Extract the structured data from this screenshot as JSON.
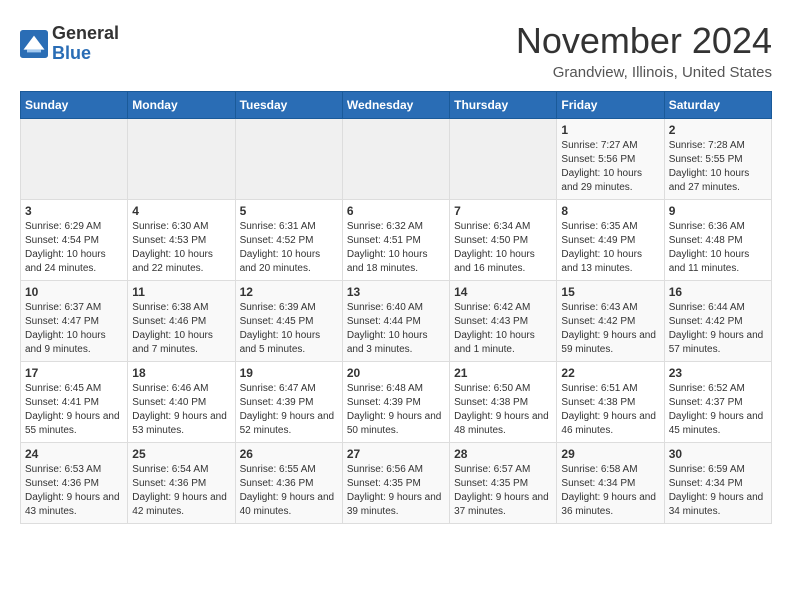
{
  "header": {
    "logo_line1": "General",
    "logo_line2": "Blue",
    "month": "November 2024",
    "location": "Grandview, Illinois, United States"
  },
  "weekdays": [
    "Sunday",
    "Monday",
    "Tuesday",
    "Wednesday",
    "Thursday",
    "Friday",
    "Saturday"
  ],
  "weeks": [
    [
      {
        "day": "",
        "info": ""
      },
      {
        "day": "",
        "info": ""
      },
      {
        "day": "",
        "info": ""
      },
      {
        "day": "",
        "info": ""
      },
      {
        "day": "",
        "info": ""
      },
      {
        "day": "1",
        "info": "Sunrise: 7:27 AM\nSunset: 5:56 PM\nDaylight: 10 hours and 29 minutes."
      },
      {
        "day": "2",
        "info": "Sunrise: 7:28 AM\nSunset: 5:55 PM\nDaylight: 10 hours and 27 minutes."
      }
    ],
    [
      {
        "day": "3",
        "info": "Sunrise: 6:29 AM\nSunset: 4:54 PM\nDaylight: 10 hours and 24 minutes."
      },
      {
        "day": "4",
        "info": "Sunrise: 6:30 AM\nSunset: 4:53 PM\nDaylight: 10 hours and 22 minutes."
      },
      {
        "day": "5",
        "info": "Sunrise: 6:31 AM\nSunset: 4:52 PM\nDaylight: 10 hours and 20 minutes."
      },
      {
        "day": "6",
        "info": "Sunrise: 6:32 AM\nSunset: 4:51 PM\nDaylight: 10 hours and 18 minutes."
      },
      {
        "day": "7",
        "info": "Sunrise: 6:34 AM\nSunset: 4:50 PM\nDaylight: 10 hours and 16 minutes."
      },
      {
        "day": "8",
        "info": "Sunrise: 6:35 AM\nSunset: 4:49 PM\nDaylight: 10 hours and 13 minutes."
      },
      {
        "day": "9",
        "info": "Sunrise: 6:36 AM\nSunset: 4:48 PM\nDaylight: 10 hours and 11 minutes."
      }
    ],
    [
      {
        "day": "10",
        "info": "Sunrise: 6:37 AM\nSunset: 4:47 PM\nDaylight: 10 hours and 9 minutes."
      },
      {
        "day": "11",
        "info": "Sunrise: 6:38 AM\nSunset: 4:46 PM\nDaylight: 10 hours and 7 minutes."
      },
      {
        "day": "12",
        "info": "Sunrise: 6:39 AM\nSunset: 4:45 PM\nDaylight: 10 hours and 5 minutes."
      },
      {
        "day": "13",
        "info": "Sunrise: 6:40 AM\nSunset: 4:44 PM\nDaylight: 10 hours and 3 minutes."
      },
      {
        "day": "14",
        "info": "Sunrise: 6:42 AM\nSunset: 4:43 PM\nDaylight: 10 hours and 1 minute."
      },
      {
        "day": "15",
        "info": "Sunrise: 6:43 AM\nSunset: 4:42 PM\nDaylight: 9 hours and 59 minutes."
      },
      {
        "day": "16",
        "info": "Sunrise: 6:44 AM\nSunset: 4:42 PM\nDaylight: 9 hours and 57 minutes."
      }
    ],
    [
      {
        "day": "17",
        "info": "Sunrise: 6:45 AM\nSunset: 4:41 PM\nDaylight: 9 hours and 55 minutes."
      },
      {
        "day": "18",
        "info": "Sunrise: 6:46 AM\nSunset: 4:40 PM\nDaylight: 9 hours and 53 minutes."
      },
      {
        "day": "19",
        "info": "Sunrise: 6:47 AM\nSunset: 4:39 PM\nDaylight: 9 hours and 52 minutes."
      },
      {
        "day": "20",
        "info": "Sunrise: 6:48 AM\nSunset: 4:39 PM\nDaylight: 9 hours and 50 minutes."
      },
      {
        "day": "21",
        "info": "Sunrise: 6:50 AM\nSunset: 4:38 PM\nDaylight: 9 hours and 48 minutes."
      },
      {
        "day": "22",
        "info": "Sunrise: 6:51 AM\nSunset: 4:38 PM\nDaylight: 9 hours and 46 minutes."
      },
      {
        "day": "23",
        "info": "Sunrise: 6:52 AM\nSunset: 4:37 PM\nDaylight: 9 hours and 45 minutes."
      }
    ],
    [
      {
        "day": "24",
        "info": "Sunrise: 6:53 AM\nSunset: 4:36 PM\nDaylight: 9 hours and 43 minutes."
      },
      {
        "day": "25",
        "info": "Sunrise: 6:54 AM\nSunset: 4:36 PM\nDaylight: 9 hours and 42 minutes."
      },
      {
        "day": "26",
        "info": "Sunrise: 6:55 AM\nSunset: 4:36 PM\nDaylight: 9 hours and 40 minutes."
      },
      {
        "day": "27",
        "info": "Sunrise: 6:56 AM\nSunset: 4:35 PM\nDaylight: 9 hours and 39 minutes."
      },
      {
        "day": "28",
        "info": "Sunrise: 6:57 AM\nSunset: 4:35 PM\nDaylight: 9 hours and 37 minutes."
      },
      {
        "day": "29",
        "info": "Sunrise: 6:58 AM\nSunset: 4:34 PM\nDaylight: 9 hours and 36 minutes."
      },
      {
        "day": "30",
        "info": "Sunrise: 6:59 AM\nSunset: 4:34 PM\nDaylight: 9 hours and 34 minutes."
      }
    ]
  ]
}
